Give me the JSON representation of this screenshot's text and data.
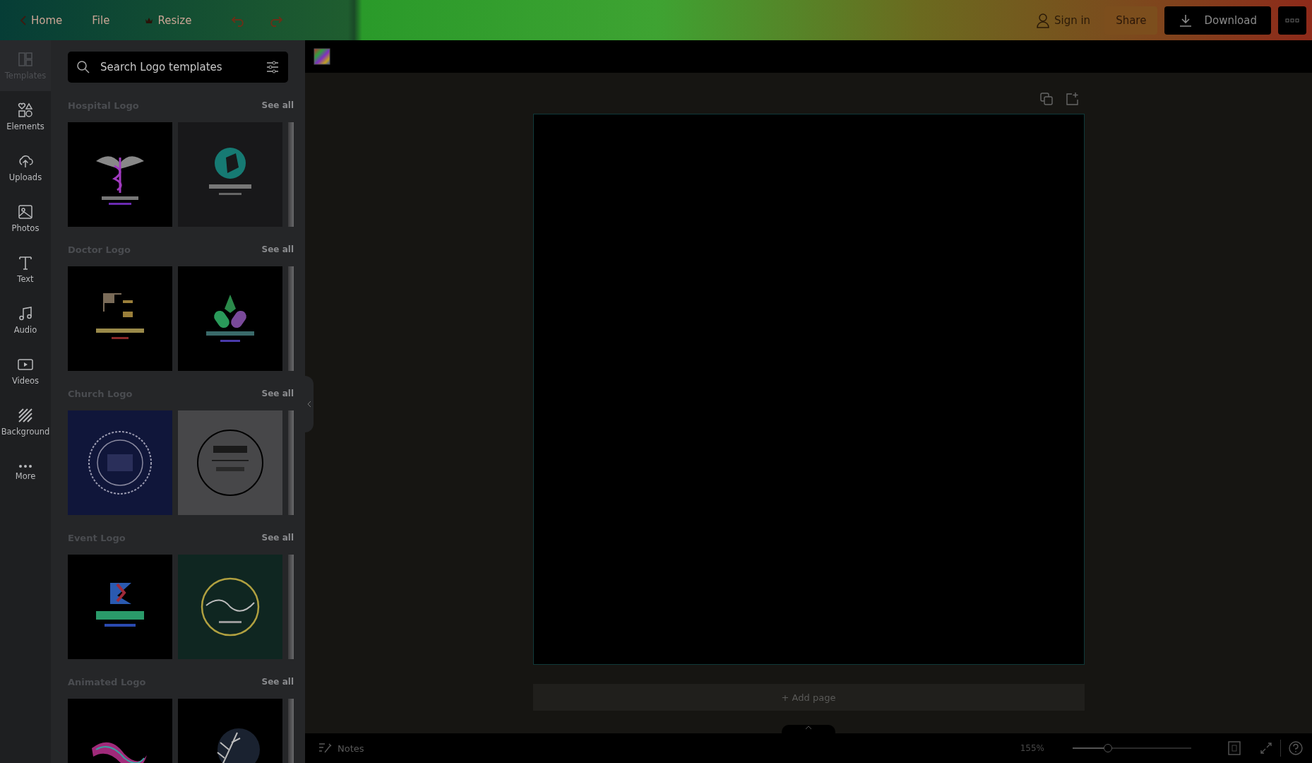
{
  "top_bar": {
    "home": "Home",
    "file": "File",
    "resize": "Resize",
    "sign_in": "Sign in",
    "share": "Share",
    "download": "Download"
  },
  "rail": [
    {
      "label": "Templates",
      "selected": true
    },
    {
      "label": "Elements",
      "selected": false
    },
    {
      "label": "Uploads",
      "selected": false
    },
    {
      "label": "Photos",
      "selected": false
    },
    {
      "label": "Text",
      "selected": false
    },
    {
      "label": "Audio",
      "selected": false
    },
    {
      "label": "Videos",
      "selected": false
    },
    {
      "label": "Background",
      "selected": false
    },
    {
      "label": "More",
      "selected": false
    }
  ],
  "search": {
    "placeholder": "Search Logo templates"
  },
  "sections": [
    {
      "title": "Hospital Logo",
      "see_all": "See all"
    },
    {
      "title": "Doctor Logo",
      "see_all": "See all"
    },
    {
      "title": "Church Logo",
      "see_all": "See all"
    },
    {
      "title": "Event Logo",
      "see_all": "See all"
    },
    {
      "title": "Animated Logo",
      "see_all": "See all"
    }
  ],
  "canvas": {
    "add_page": "+ Add page"
  },
  "bottom_bar": {
    "notes": "Notes",
    "zoom": "155%",
    "zoom_slider": {
      "level": 0.3
    }
  }
}
